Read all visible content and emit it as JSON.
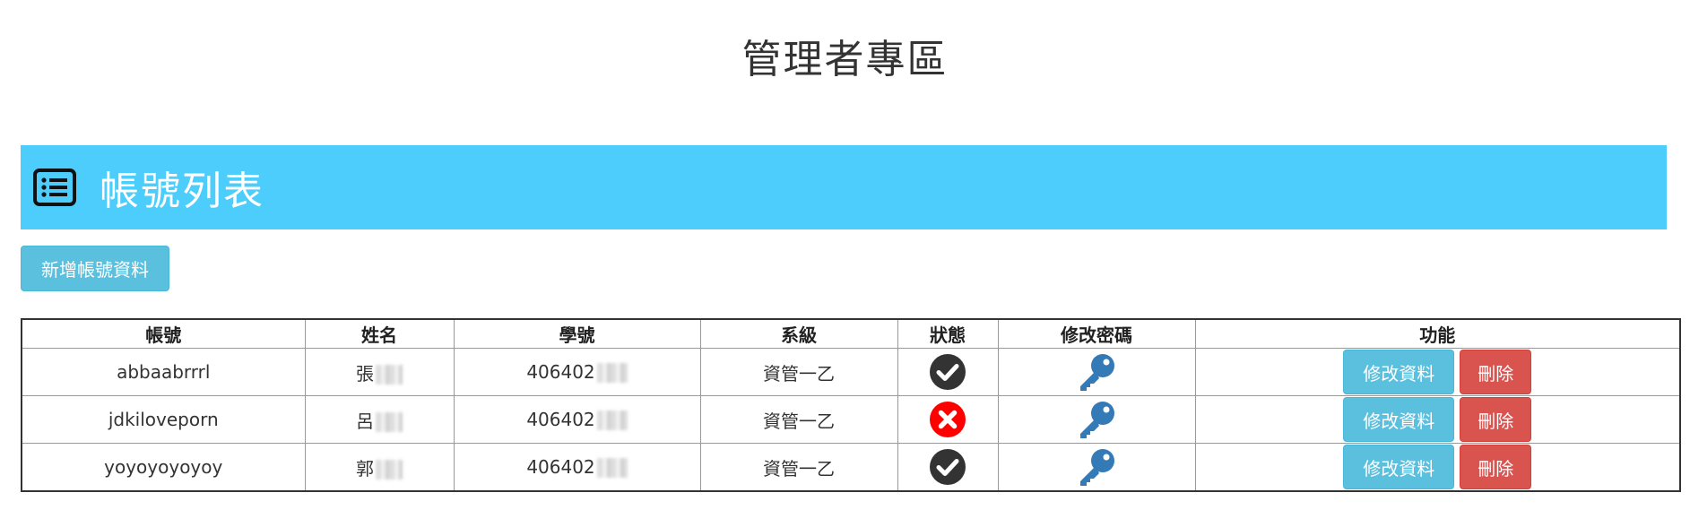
{
  "page": {
    "title": "管理者專區"
  },
  "banner": {
    "title": "帳號列表",
    "icon": "list-icon",
    "color": "#4ccdfb"
  },
  "toolbar": {
    "add_label": "新增帳號資料"
  },
  "table": {
    "headers": [
      "帳號",
      "姓名",
      "學號",
      "系級",
      "狀態",
      "修改密碼",
      "功能"
    ],
    "rows": [
      {
        "account": "abbaabrrrl",
        "name": "張",
        "student_id": "406402",
        "class": "資管一乙",
        "status": "active",
        "status_icon": "check-circle-icon",
        "edit_label": "修改資料",
        "delete_label": "刪除"
      },
      {
        "account": "jdkiloveporn",
        "name": "呂",
        "student_id": "406402",
        "class": "資管一乙",
        "status": "disabled",
        "status_icon": "x-circle-icon",
        "edit_label": "修改資料",
        "delete_label": "刪除"
      },
      {
        "account": "yoyoyoyoyoy",
        "name": "郭",
        "student_id": "406402",
        "class": "資管一乙",
        "status": "active",
        "status_icon": "check-circle-icon",
        "edit_label": "修改資料",
        "delete_label": "刪除"
      }
    ]
  },
  "colors": {
    "info": "#5bc0de",
    "danger": "#d9534f",
    "key": "#337ab7",
    "active": "#333333",
    "disabled": "#ff0000"
  }
}
